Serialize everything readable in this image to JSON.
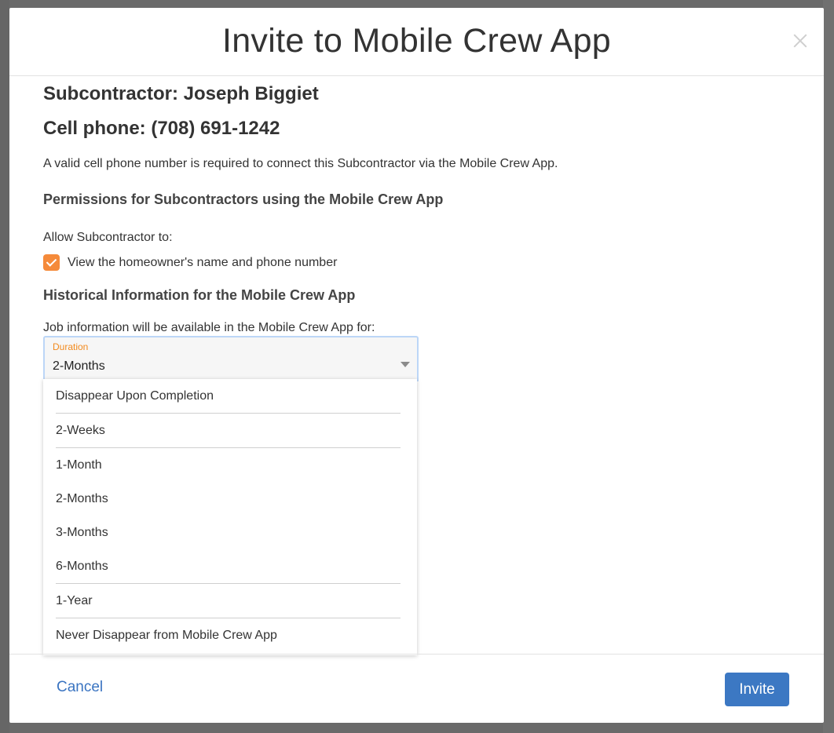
{
  "modal": {
    "title": "Invite to Mobile Crew App",
    "subcontractor": "Subcontractor: Joseph Biggiet",
    "cell_phone": "Cell phone: (708) 691-1242",
    "phone_note": "A valid cell phone number is required to connect this Subcontractor via the Mobile Crew App.",
    "permissions_heading": "Permissions for Subcontractors using the Mobile Crew App",
    "allow_text": "Allow Subcontractor to:",
    "permission_checkbox": {
      "label": "View the homeowner's name and phone number",
      "checked": true
    },
    "historical_heading": "Historical Information for the Mobile Crew App",
    "historical_text": "Job information will be available in the Mobile Crew App for:",
    "duration_select": {
      "label": "Duration",
      "value": "2-Months",
      "options": [
        "Disappear Upon Completion",
        "2-Weeks",
        "1-Month",
        "2-Months",
        "3-Months",
        "6-Months",
        "1-Year",
        "Never Disappear from Mobile Crew App"
      ]
    },
    "cancel_label": "Cancel",
    "invite_label": "Invite"
  },
  "colors": {
    "accent_orange": "#f58a3a",
    "primary_blue": "#3c78c3",
    "link_blue": "#3a74c1",
    "select_label_orange": "#f28a1e"
  },
  "icons": {
    "close": "close-icon",
    "caret": "chevron-down-icon",
    "check": "checkmark-icon"
  }
}
